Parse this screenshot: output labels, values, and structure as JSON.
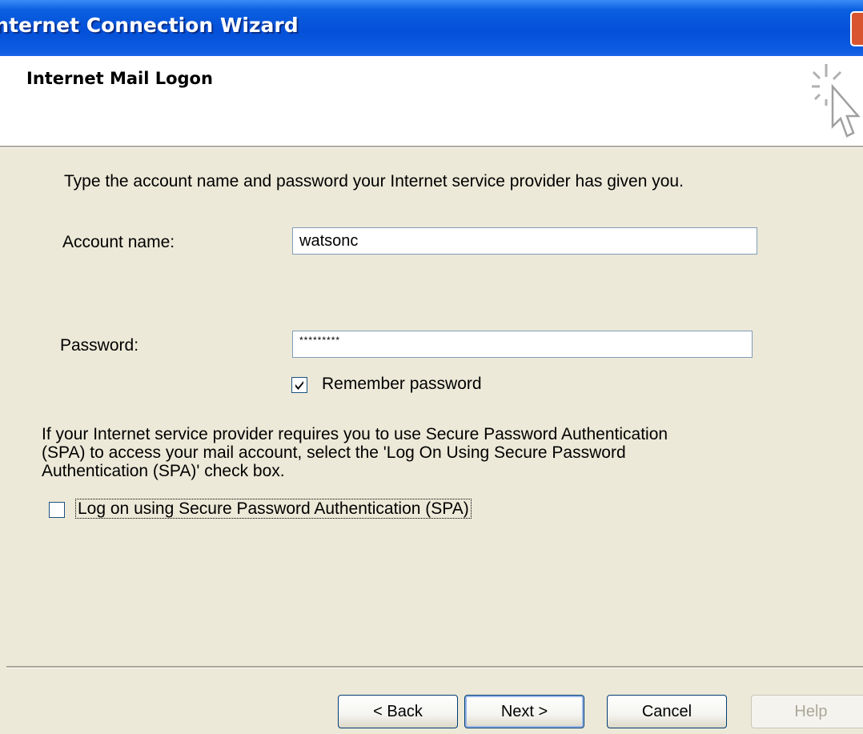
{
  "window": {
    "title": "Internet Connection Wizard"
  },
  "header": {
    "heading": "Internet Mail Logon"
  },
  "instructions": "Type the account name and password your Internet service provider has given you.",
  "account": {
    "label": "Account name:",
    "value": "watsonc"
  },
  "password": {
    "label": "Password:",
    "masked_value": "*********"
  },
  "remember_password": {
    "label": "Remember password",
    "checked": true
  },
  "spa": {
    "line1": "If your Internet service provider requires you to use Secure Password Authentication",
    "line2": "(SPA) to access your mail account, select the 'Log On Using Secure Password",
    "line3": "Authentication (SPA)' check box.",
    "checkbox_label": "Log on using Secure Password Authentication (SPA)",
    "checked": false
  },
  "buttons": {
    "back": "< Back",
    "next": "Next >",
    "cancel": "Cancel",
    "help": "Help"
  }
}
